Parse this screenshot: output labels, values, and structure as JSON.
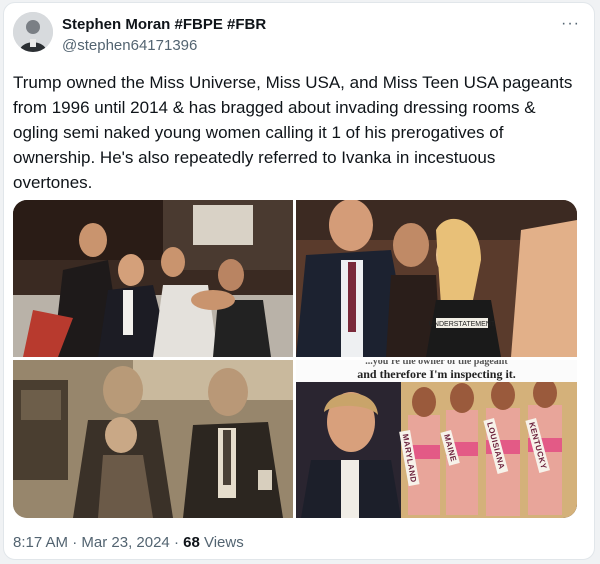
{
  "author": {
    "display_name": "Stephen Moran #FBPE #FBR",
    "handle": "@stephen64171396",
    "avatar_icon": "user-avatar"
  },
  "menu": {
    "more_label": "···"
  },
  "tweet": {
    "text": "Trump owned the Miss Universe, Miss USA, and Miss Teen USA pageants from 1996 until 2014 & has bragged about invading dressing rooms & ogling semi naked young women calling it 1 of his prerogatives of ownership. He's also repeatedly referred to Ivanka in incestuous overtones."
  },
  "media": {
    "caption_partial": "...you're the owner of the pageant",
    "caption": "and therefore I'm inspecting it.",
    "sashes": [
      "MARYLAND",
      "MAINE",
      "LOUISIANA",
      "KENTUCKY"
    ],
    "tank_top_text": "UNDERSTATEMENT"
  },
  "meta": {
    "time": "8:17 AM",
    "separator": "·",
    "date": "Mar 23, 2024",
    "views_count": "68",
    "views_label": "Views"
  }
}
